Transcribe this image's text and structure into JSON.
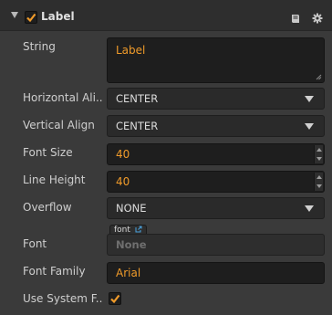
{
  "component": {
    "title": "Label",
    "enabled": true
  },
  "header_icons": [
    "book-icon",
    "gear-icon"
  ],
  "properties": {
    "string": {
      "label": "String",
      "value": "Label"
    },
    "horizontal_align": {
      "label": "Horizontal Ali...",
      "value": "CENTER"
    },
    "vertical_align": {
      "label": "Vertical Align",
      "value": "CENTER"
    },
    "font_size": {
      "label": "Font Size",
      "value": "40"
    },
    "line_height": {
      "label": "Line Height",
      "value": "40"
    },
    "overflow": {
      "label": "Overflow",
      "value": "NONE"
    },
    "font": {
      "label": "Font",
      "asset_type": "font",
      "value": "None"
    },
    "font_family": {
      "label": "Font Family",
      "value": "Arial"
    },
    "use_system_font": {
      "label": "Use System F...",
      "checked": true
    }
  },
  "colors": {
    "accent": "#f09b2a",
    "background": "#3a3a3a",
    "field": "#1e1e1e"
  }
}
